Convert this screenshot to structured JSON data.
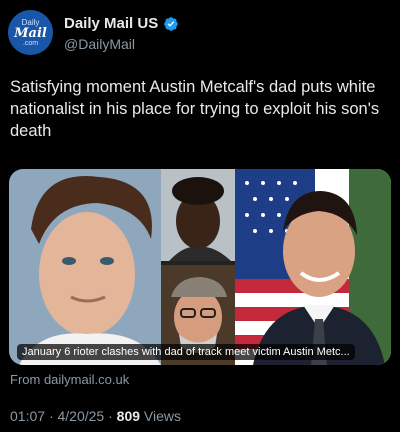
{
  "account": {
    "avatar_line1": "Daily",
    "avatar_line2": "Mail",
    "avatar_line3": ".com",
    "name": "Daily Mail US",
    "handle": "@DailyMail"
  },
  "post": {
    "text": "Satisfying moment Austin Metcalf's dad puts white nationalist in his place for trying to exploit his son's death"
  },
  "card": {
    "caption": "January 6 rioter clashes with dad of track meet victim Austin Metc...",
    "source": "From dailymail.co.uk"
  },
  "meta": {
    "time": "01:07",
    "date": "4/20/25",
    "views_count": "809",
    "views_label": "Views"
  },
  "colors": {
    "background": "#000000",
    "verified": "#1d9bf0",
    "muted": "#8b98a5"
  }
}
